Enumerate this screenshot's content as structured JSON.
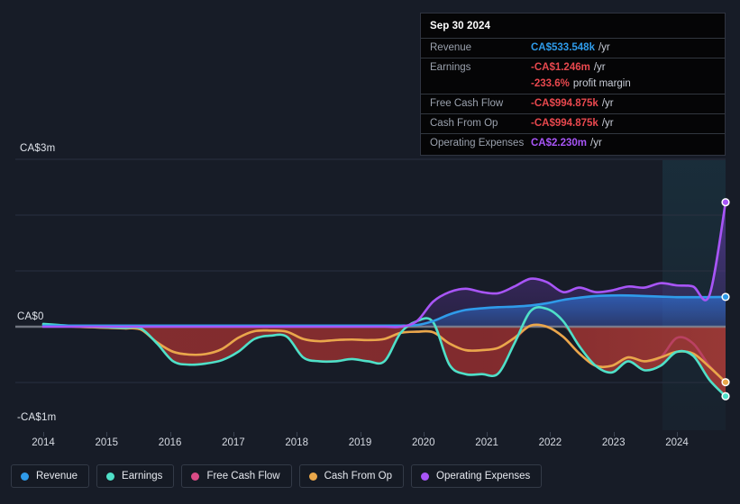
{
  "chart_data": {
    "type": "line",
    "title": "",
    "xlabel": "",
    "ylabel": "",
    "currency": "CA$",
    "ylim": [
      -1.3,
      3.0
    ],
    "y_ticks": [
      {
        "label": "CA$3m",
        "value": 3.0
      },
      {
        "label": "CA$0",
        "value": 0
      },
      {
        "label": "-CA$1m",
        "value": -1.0
      }
    ],
    "gridlines": [
      3.0,
      2.0,
      1.0,
      0,
      -1.0
    ],
    "grid": true,
    "legend_position": "bottom-left",
    "x_ticks": [
      "2014",
      "2015",
      "2016",
      "2017",
      "2018",
      "2019",
      "2020",
      "2021",
      "2022",
      "2023",
      "2024"
    ],
    "series": [
      {
        "name": "Revenue",
        "color": "#2f9bea",
        "values": [
          0.02,
          0.02,
          0.02,
          0.02,
          0.02,
          0.02,
          0.02,
          0.02,
          0.02,
          0.02,
          0.02,
          0.02,
          0.02,
          0.02,
          0.02,
          0.02,
          0.02,
          0.02,
          0.02,
          0.02,
          0.02,
          0.02,
          0.02,
          0.03,
          0.1,
          0.22,
          0.3,
          0.33,
          0.35,
          0.36,
          0.38,
          0.42,
          0.48,
          0.52,
          0.55,
          0.56,
          0.56,
          0.55,
          0.54,
          0.53,
          0.53,
          0.53,
          0.533548
        ]
      },
      {
        "name": "Earnings",
        "color": "#4fe0c8",
        "values": [
          0.05,
          0.03,
          0.01,
          0.0,
          -0.01,
          -0.02,
          -0.03,
          -0.3,
          -0.62,
          -0.68,
          -0.66,
          -0.6,
          -0.45,
          -0.22,
          -0.16,
          -0.18,
          -0.55,
          -0.62,
          -0.62,
          -0.58,
          -0.62,
          -0.62,
          -0.11,
          0.1,
          0.08,
          -0.68,
          -0.85,
          -0.85,
          -0.84,
          -0.3,
          0.28,
          0.32,
          0.1,
          -0.35,
          -0.7,
          -0.82,
          -0.62,
          -0.78,
          -0.7,
          -0.45,
          -0.52,
          -0.95,
          -1.246
        ]
      },
      {
        "name": "Free Cash Flow",
        "color": "#d94b86",
        "values": [
          0.04,
          0.02,
          0.0,
          -0.01,
          -0.02,
          -0.03,
          -0.05,
          -0.28,
          -0.45,
          -0.5,
          -0.49,
          -0.4,
          -0.2,
          -0.08,
          -0.07,
          -0.09,
          -0.22,
          -0.26,
          -0.24,
          -0.23,
          -0.24,
          -0.22,
          -0.11,
          -0.09,
          -0.1,
          -0.3,
          -0.42,
          -0.42,
          -0.38,
          -0.2,
          0.02,
          0.0,
          -0.18,
          -0.48,
          -0.7,
          -0.7,
          -0.55,
          -0.62,
          -0.55,
          -0.2,
          -0.3,
          -0.7,
          -0.994875
        ]
      },
      {
        "name": "Cash From Op",
        "color": "#e9a74a",
        "values": [
          0.04,
          0.02,
          0.0,
          -0.01,
          -0.02,
          -0.03,
          -0.05,
          -0.28,
          -0.45,
          -0.5,
          -0.49,
          -0.4,
          -0.2,
          -0.08,
          -0.07,
          -0.09,
          -0.22,
          -0.26,
          -0.24,
          -0.23,
          -0.24,
          -0.22,
          -0.11,
          -0.09,
          -0.1,
          -0.3,
          -0.42,
          -0.42,
          -0.38,
          -0.2,
          0.02,
          0.0,
          -0.18,
          -0.48,
          -0.7,
          -0.7,
          -0.55,
          -0.62,
          -0.55,
          -0.45,
          -0.48,
          -0.72,
          -0.994875
        ]
      },
      {
        "name": "Operating Expenses",
        "color": "#a855f7",
        "values": [
          0.0,
          0.0,
          0.0,
          0.0,
          0.0,
          0.0,
          0.0,
          0.0,
          0.0,
          0.0,
          0.0,
          0.0,
          0.0,
          0.0,
          0.0,
          0.0,
          0.0,
          0.0,
          0.0,
          0.0,
          0.0,
          0.0,
          0.0,
          0.1,
          0.45,
          0.62,
          0.68,
          0.62,
          0.6,
          0.72,
          0.86,
          0.8,
          0.62,
          0.7,
          0.62,
          0.65,
          0.72,
          0.7,
          0.78,
          0.74,
          0.72,
          0.56,
          2.23
        ]
      }
    ]
  },
  "axis": {
    "y_top": "CA$3m",
    "y_zero": "CA$0",
    "y_bottom": "-CA$1m",
    "x_labels": [
      "2014",
      "2015",
      "2016",
      "2017",
      "2018",
      "2019",
      "2020",
      "2021",
      "2022",
      "2023",
      "2024"
    ]
  },
  "tooltip": {
    "date": "Sep 30 2024",
    "rows": [
      {
        "key": "Revenue",
        "value": "CA$533.548k",
        "unit": "/yr",
        "color": "#2f9bea"
      },
      {
        "key": "Earnings",
        "value": "-CA$1.246m",
        "unit": "/yr",
        "color": "#e8484e"
      },
      {
        "key": "",
        "value": "-233.6%",
        "unit": "profit margin",
        "color": "#e8484e",
        "sub": true
      },
      {
        "key": "Free Cash Flow",
        "value": "-CA$994.875k",
        "unit": "/yr",
        "color": "#e8484e"
      },
      {
        "key": "Cash From Op",
        "value": "-CA$994.875k",
        "unit": "/yr",
        "color": "#e8484e"
      },
      {
        "key": "Operating Expenses",
        "value": "CA$2.230m",
        "unit": "/yr",
        "color": "#a855f7"
      }
    ]
  },
  "legend": {
    "items": [
      {
        "label": "Revenue",
        "color": "#2f9bea"
      },
      {
        "label": "Earnings",
        "color": "#4fe0c8"
      },
      {
        "label": "Free Cash Flow",
        "color": "#d94b86"
      },
      {
        "label": "Cash From Op",
        "color": "#e9a74a"
      },
      {
        "label": "Operating Expenses",
        "color": "#a855f7"
      }
    ]
  },
  "colors": {
    "background": "#171c27",
    "gridline": "#2a3140",
    "zero_line": "#8a8f99",
    "negative_fill": "#8c2f30",
    "forecast_band": "#1b2a33"
  }
}
